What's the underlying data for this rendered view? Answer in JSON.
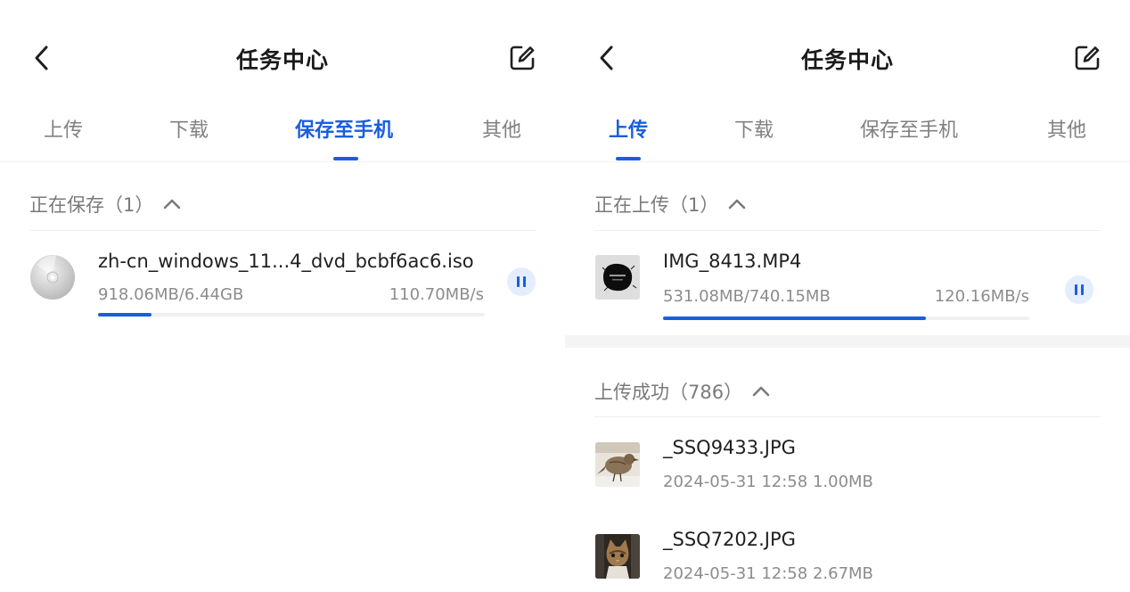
{
  "colors": {
    "accent": "#1a5ee0",
    "muted": "#808080",
    "text": "#1f1f1f"
  },
  "left": {
    "title": "任务中心",
    "tabs": [
      {
        "label": "上传",
        "active": false
      },
      {
        "label": "下载",
        "active": false
      },
      {
        "label": "保存至手机",
        "active": true
      },
      {
        "label": "其他",
        "active": false
      }
    ],
    "in_progress": {
      "heading": "正在保存（1）",
      "item": {
        "icon": "disc-icon",
        "name": "zh-cn_windows_11...4_dvd_bcbf6ac6.iso",
        "progress_text": "918.06MB/6.44GB",
        "speed": "110.70MB/s",
        "progress": 0.139
      }
    }
  },
  "right": {
    "title": "任务中心",
    "tabs": [
      {
        "label": "上传",
        "active": true
      },
      {
        "label": "下载",
        "active": false
      },
      {
        "label": "保存至手机",
        "active": false
      },
      {
        "label": "其他",
        "active": false
      }
    ],
    "in_progress": {
      "heading": "正在上传（1）",
      "item": {
        "name": "IMG_8413.MP4",
        "progress_text": "531.08MB/740.15MB",
        "speed": "120.16MB/s",
        "progress": 0.718
      }
    },
    "completed": {
      "heading": "上传成功（786）",
      "items": [
        {
          "name": "_SSQ9433.JPG",
          "date": "2024-05-31 12:58",
          "size": "1.00MB"
        },
        {
          "name": "_SSQ7202.JPG",
          "date": "2024-05-31 12:58",
          "size": "2.67MB"
        }
      ]
    }
  }
}
